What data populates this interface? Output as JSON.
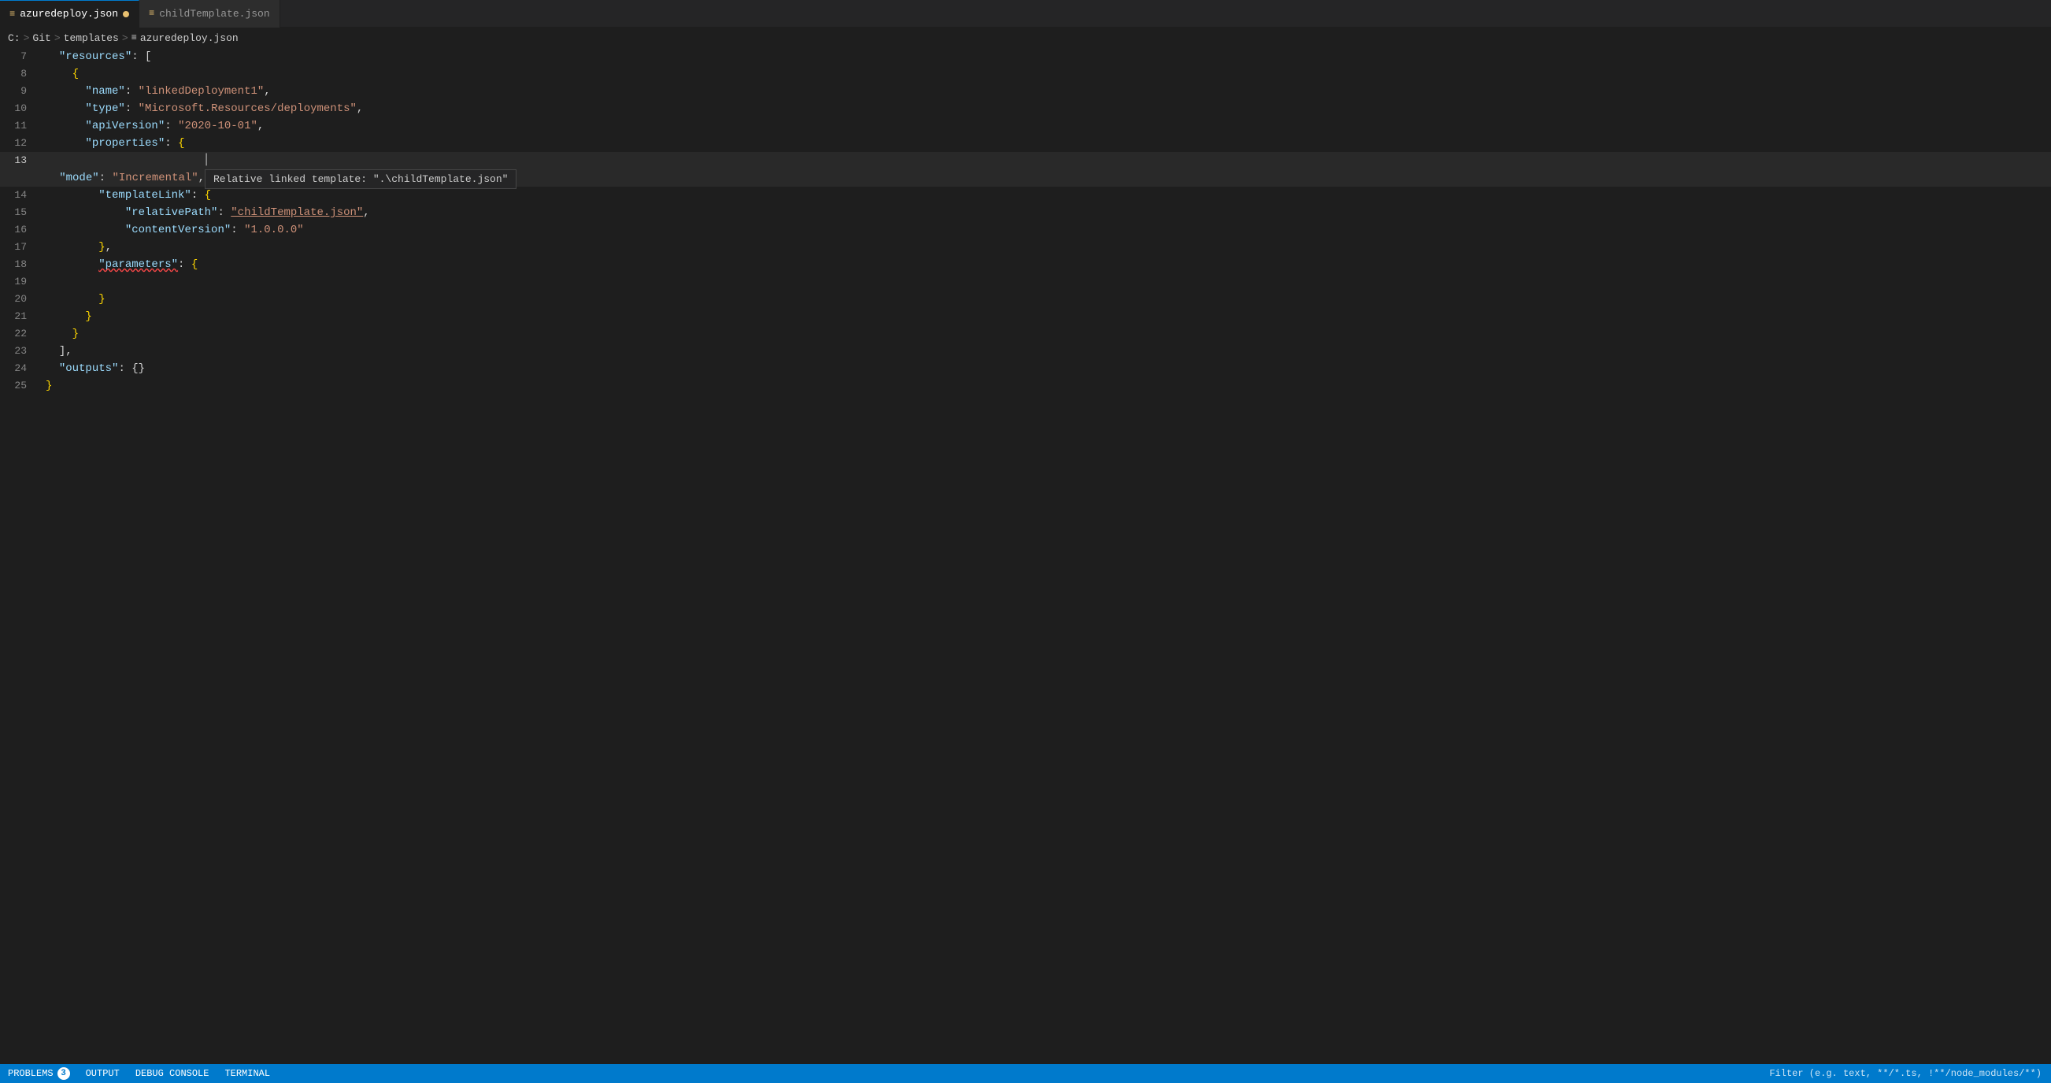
{
  "tabs": [
    {
      "name": "azuredeploy.json",
      "active": true,
      "modified": true,
      "icon": "{}"
    },
    {
      "name": "childTemplate.json",
      "active": false,
      "modified": false,
      "icon": "{}"
    }
  ],
  "breadcrumb": {
    "parts": [
      "C:",
      "Git",
      "templates",
      "azuredeploy.json"
    ]
  },
  "lines": [
    {
      "num": 7,
      "content": "  \"resources\": ["
    },
    {
      "num": 8,
      "content": "    {"
    },
    {
      "num": 9,
      "content": "      \"name\": \"linkedDeployment1\","
    },
    {
      "num": 10,
      "content": "      \"type\": \"Microsoft.Resources/deployments\","
    },
    {
      "num": 11,
      "content": "      \"apiVersion\": \"2020-10-01\","
    },
    {
      "num": 12,
      "content": "      \"properties\": {"
    },
    {
      "num": 13,
      "content": "        \"mode\": \"Incremental\","
    },
    {
      "num": 14,
      "content": "        \"templateLink\": {"
    },
    {
      "num": 15,
      "content": "            \"relativePath\": \"childTemplate.json\","
    },
    {
      "num": 16,
      "content": "            \"contentVersion\": \"1.0.0.0\""
    },
    {
      "num": 17,
      "content": "        },"
    },
    {
      "num": 18,
      "content": "        \"parameters\": {"
    },
    {
      "num": 19,
      "content": ""
    },
    {
      "num": 20,
      "content": "        }"
    },
    {
      "num": 21,
      "content": "      }"
    },
    {
      "num": 22,
      "content": "    }"
    },
    {
      "num": 23,
      "content": "  ],"
    },
    {
      "num": 24,
      "content": "  \"outputs\": {}"
    },
    {
      "num": 25,
      "content": "}"
    }
  ],
  "tooltip": {
    "text": "Relative linked template: \".\\childTemplate.json\""
  },
  "status_bar": {
    "problems_label": "PROBLEMS",
    "problems_count": "3",
    "output_label": "OUTPUT",
    "debug_label": "DEBUG CONSOLE",
    "terminal_label": "TERMINAL",
    "filter_placeholder": "Filter (e.g. text, **/*.ts, !**/node_modules/**)"
  }
}
